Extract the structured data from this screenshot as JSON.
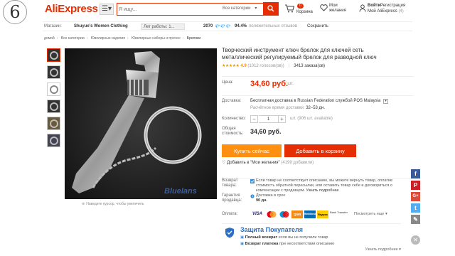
{
  "header": {
    "brand": "AliExpress",
    "search_placeholder": "Я ищу...",
    "search_category": "Все категории",
    "cart_count": "0",
    "cart_label": "Корзина",
    "wish_label": "Мои желания",
    "login": "Войти",
    "register": "Регистрация",
    "my_aliexpress": "Мой AliExpress",
    "my_aliexpress_count": "(4)"
  },
  "store": {
    "label": "Магазин:",
    "name": "Shuyue's Women Clothing",
    "pill": "Лет работы: 1...",
    "score": "2070",
    "diamonds": "💎💎💎",
    "positive_pct": "94.4%",
    "positive_label": "положительных отзывов",
    "save": "Сохранить"
  },
  "breadcrumb": [
    "домой",
    "Все категории",
    "Ювелирные изделия",
    "Ювелирные наборы и прочее",
    "Брелоки"
  ],
  "product": {
    "title": "Творческий инструмент ключ брелок для ключей сеть металлический регулируемый брелок для разводной ключ",
    "stars": "★★★★★",
    "rating": "4.9",
    "reviews": "(1012 голосов(ов))",
    "orders": "3413 заказа(ов)",
    "price_label": "Цена:",
    "price": "34,60 руб.",
    "unit": "/ шт.",
    "shipping_label": "Доставка:",
    "shipping_text": "Бесплатная доставка в Russian Federation службой POS Malaysia",
    "shipping_time_label": "Расчётное время доставки:",
    "shipping_time": "32–53 дн.",
    "qty_label": "Количество:",
    "qty_minus": "−",
    "qty_value": "1",
    "qty_plus": "+",
    "qty_available": "шт. (906 шт. available)",
    "total_label": "Общая стоимость:",
    "total": "34,60 руб.",
    "buy_now": "Купить сейчас",
    "add_to_cart": "Добавить в корзину",
    "add_to_wish": "Добавить в \"Мои желания\"",
    "wish_count": "(4199 добавили)",
    "zoom_hint": "Наведите курсор, чтобы увеличить",
    "return_label": "Возврат товара:",
    "return_text": "Если товар не соответствует описанию, вы можете вернуть товар, оплатив стоимость обратной пересылки, или оставить товар себе и договориться о компенсации с продавцом.",
    "return_more": "Узнать подробнее",
    "guarantee_label": "Гарантия продавца:",
    "guarantee_text": "Доставка в срок",
    "guarantee_days": "90 дн.",
    "payment_label": "Оплата:",
    "payment_more": "Посмотреть еще",
    "protect_title": "Защита Покупателя",
    "protect_full": "Полный возврат",
    "protect_full_rest": "если вы не получили товар",
    "protect_pay": "Возврат платежа",
    "protect_pay_rest": "при несоответствии описанию",
    "protect_more": "Узнать подробнее"
  },
  "payments": [
    "VISA",
    "MC",
    "Maestro",
    "QIWI",
    "WebMoney",
    "Яндекс",
    "Bank Transfer"
  ],
  "colors": {
    "brand": "#e62e04",
    "buy_now": "#fe8f10",
    "add_cart": "#e62e04",
    "link_blue": "#2d6fc0"
  },
  "social": [
    "f",
    "P",
    "G+",
    "t",
    "✎"
  ]
}
